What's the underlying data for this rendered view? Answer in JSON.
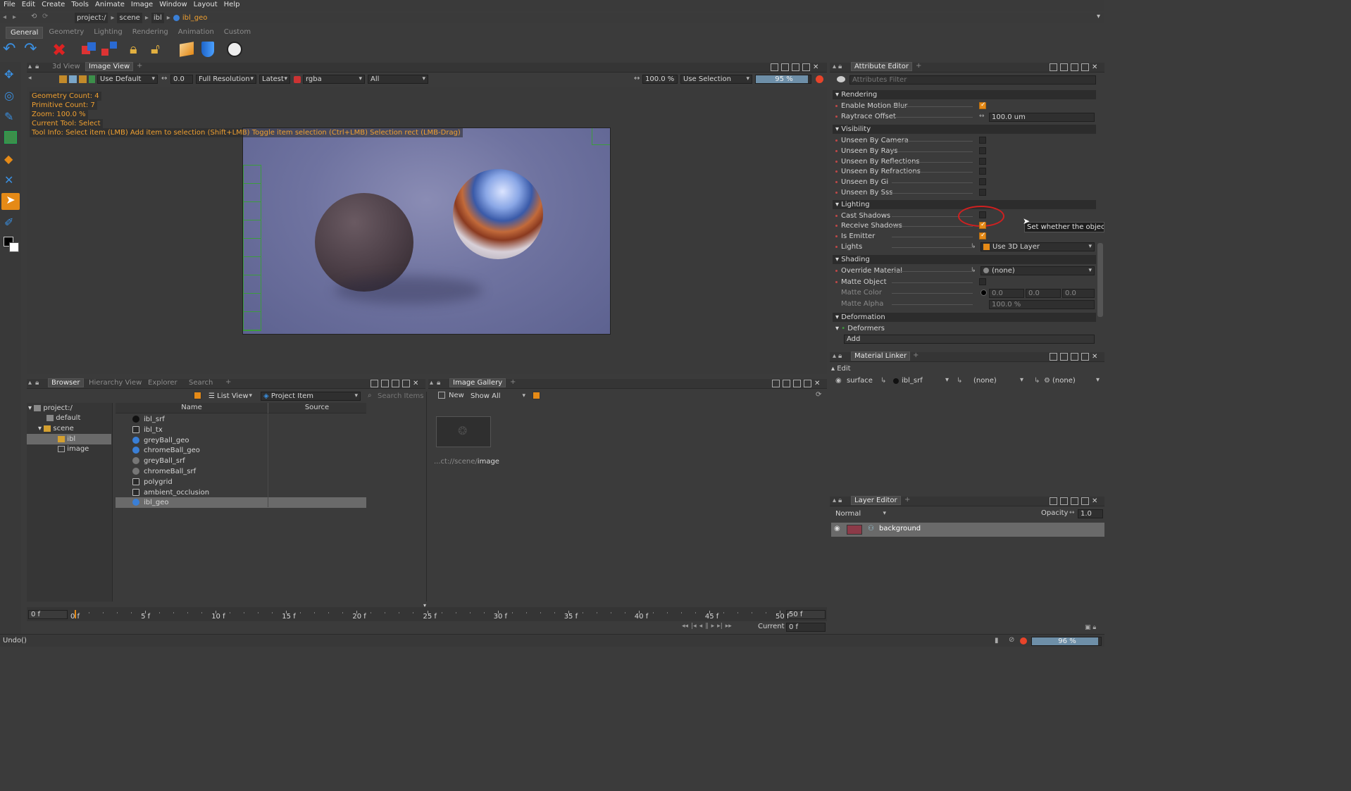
{
  "menubar": {
    "items": [
      "File",
      "Edit",
      "Create",
      "Tools",
      "Animate",
      "Image",
      "Window",
      "Layout",
      "Help"
    ]
  },
  "breadcrumb": {
    "items": [
      "project:/",
      "scene",
      "ibl"
    ],
    "current": "ibl_geo"
  },
  "shelf_tabs": [
    "General",
    "Geometry",
    "Lighting",
    "Rendering",
    "Animation",
    "Custom"
  ],
  "viewer": {
    "tabs": [
      "3d View",
      "Image View"
    ],
    "lut": "Use Default",
    "exposure": "0.0",
    "resolution": "Full Resolution",
    "version": "Latest",
    "channels": "rgba",
    "layers": "All",
    "zoom_pct": "100.0 %",
    "selection_mode": "Use Selection",
    "progress": "95 %",
    "overlay": [
      "Geometry Count: 4",
      "Primitive Count: 7",
      "Zoom: 100.0 %",
      "Current Tool: Select",
      "Tool Info: Select item (LMB)  Add item to selection (Shift+LMB)  Toggle item selection (Ctrl+LMB)  Selection rect (LMB-Drag)"
    ]
  },
  "attribute_editor": {
    "title": "Attribute Editor",
    "filter_placeholder": "Attributes Filter",
    "sections": {
      "rendering": "Rendering",
      "visibility": "Visibility",
      "lighting": "Lighting",
      "shading": "Shading",
      "deformation": "Deformation"
    },
    "attrs": {
      "enable_motion_blur": "Enable Motion Blur",
      "raytrace_offset": "Raytrace Offset",
      "raytrace_offset_value": "100.0 um",
      "unseen_camera": "Unseen By Camera",
      "unseen_rays": "Unseen By Rays",
      "unseen_reflections": "Unseen By Reflections",
      "unseen_refractions": "Unseen By Refractions",
      "unseen_gi": "Unseen By Gi",
      "unseen_sss": "Unseen By Sss",
      "cast_shadows": "Cast Shadows",
      "receive_shadows": "Receive Shadows",
      "is_emitter": "Is Emitter",
      "lights": "Lights",
      "lights_value": "Use 3D Layer",
      "override_material": "Override Material",
      "override_material_value": "(none)",
      "matte_object": "Matte Object",
      "matte_color": "Matte Color",
      "matte_color_values": [
        "0.0",
        "0.0",
        "0.0"
      ],
      "matte_alpha": "Matte Alpha",
      "matte_alpha_value": "100.0 %",
      "deformers": "Deformers",
      "add": "Add"
    },
    "tooltip": "Set whether the object c"
  },
  "material_linker": {
    "title": "Material Linker",
    "edit": "Edit",
    "row": {
      "type": "surface",
      "material": "ibl_srf",
      "layer": "(none)",
      "light": "(none)"
    }
  },
  "layer_editor": {
    "title": "Layer Editor",
    "blend": "Normal",
    "opacity_label": "Opacity",
    "opacity": "1.0",
    "layer": "background"
  },
  "browser": {
    "tabs": [
      "Browser",
      "Hierarchy View",
      "Explorer",
      "Search"
    ],
    "view": "List View",
    "filter": "Project Item",
    "search_placeholder": "Search Items",
    "tree": [
      "project:/",
      "default",
      "scene",
      "ibl",
      "image"
    ],
    "columns": [
      "Name",
      "Source"
    ],
    "items": [
      "ibl_srf",
      "ibl_tx",
      "greyBall_geo",
      "chromeBall_geo",
      "greyBall_srf",
      "chromeBall_srf",
      "polygrid",
      "ambient_occlusion",
      "ibl_geo"
    ]
  },
  "gallery": {
    "title": "Image Gallery",
    "new": "New",
    "filter": "Show All",
    "caption_prefix": "...ct://scene/",
    "caption_name": "image"
  },
  "timeline": {
    "start": "0 f",
    "end": "50 f",
    "ticks": [
      "0 f",
      "5 f",
      "10 f",
      "15 f",
      "20 f",
      "25 f",
      "30 f",
      "35 f",
      "40 f",
      "45 f",
      "50 f"
    ],
    "current_label": "Current",
    "current": "0 f"
  },
  "status": {
    "message": "Undo()",
    "progress": "96 %"
  },
  "colors": {
    "accent": "#e58a17",
    "selection": "#6a6a6a",
    "overlay_text": "#f0a030"
  }
}
